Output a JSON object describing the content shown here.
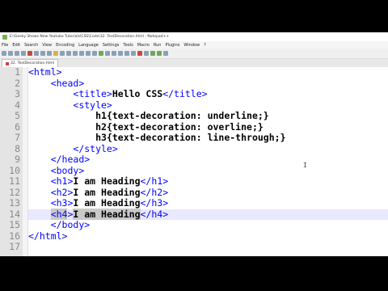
{
  "window": {
    "title": "E:\\Geeky Shows New Youtube Tutorials\\CSS\\Code\\32. TextDecoration.html - Notepad++"
  },
  "menu": [
    "File",
    "Edit",
    "Search",
    "View",
    "Encoding",
    "Language",
    "Settings",
    "Tools",
    "Macro",
    "Run",
    "Plugins",
    "Window",
    "?"
  ],
  "tab": {
    "label": "32. TextDecoration.html"
  },
  "mouse_cursor_glyph": "I",
  "editor": {
    "current_line": 14,
    "lines": [
      {
        "num": "1",
        "indent": "",
        "parts": [
          {
            "t": "<html>",
            "c": "tag"
          }
        ]
      },
      {
        "num": "2",
        "indent": "    ",
        "parts": [
          {
            "t": "<head>",
            "c": "tag"
          }
        ]
      },
      {
        "num": "3",
        "indent": "        ",
        "parts": [
          {
            "t": "<title>",
            "c": "tag"
          },
          {
            "t": "Hello CSS",
            "c": "txt"
          },
          {
            "t": "</title>",
            "c": "tag"
          }
        ]
      },
      {
        "num": "4",
        "indent": "        ",
        "parts": [
          {
            "t": "<style>",
            "c": "tag"
          }
        ]
      },
      {
        "num": "5",
        "indent": "            ",
        "parts": [
          {
            "t": "h1{text-decoration: underline;}",
            "c": "css"
          }
        ]
      },
      {
        "num": "6",
        "indent": "            ",
        "parts": [
          {
            "t": "h2{text-decoration: overline;}",
            "c": "css"
          }
        ]
      },
      {
        "num": "7",
        "indent": "            ",
        "parts": [
          {
            "t": "h3{text-decoration: line-through;}",
            "c": "css"
          }
        ]
      },
      {
        "num": "8",
        "indent": "        ",
        "parts": [
          {
            "t": "</style>",
            "c": "tag"
          }
        ]
      },
      {
        "num": "9",
        "indent": "    ",
        "parts": [
          {
            "t": "</head>",
            "c": "tag"
          }
        ]
      },
      {
        "num": "10",
        "indent": "    ",
        "parts": [
          {
            "t": "<body>",
            "c": "tag"
          }
        ]
      },
      {
        "num": "11",
        "indent": "    ",
        "parts": [
          {
            "t": "<h1>",
            "c": "tag"
          },
          {
            "t": "I am Heading",
            "c": "txt"
          },
          {
            "t": "</h1>",
            "c": "tag"
          }
        ]
      },
      {
        "num": "12",
        "indent": "    ",
        "parts": [
          {
            "t": "<h2>",
            "c": "tag"
          },
          {
            "t": "I am Heading",
            "c": "txt"
          },
          {
            "t": "</h2>",
            "c": "tag"
          }
        ]
      },
      {
        "num": "13",
        "indent": "    ",
        "parts": [
          {
            "t": "<h3>",
            "c": "tag"
          },
          {
            "t": "I am Heading",
            "c": "txt"
          },
          {
            "t": "</h3>",
            "c": "tag"
          }
        ]
      },
      {
        "num": "14",
        "indent": "    ",
        "parts": [
          {
            "t": "<h4",
            "c": "tag",
            "hl": true
          },
          {
            "t": ">",
            "c": "tag"
          },
          {
            "t": "I am Heading",
            "c": "txt",
            "hl": true
          },
          {
            "t": "</h4>",
            "c": "tag"
          }
        ]
      },
      {
        "num": "15",
        "indent": "    ",
        "parts": [
          {
            "t": "</body>",
            "c": "tag"
          }
        ]
      },
      {
        "num": "16",
        "indent": "",
        "parts": [
          {
            "t": "</html>",
            "c": "tag"
          }
        ]
      },
      {
        "num": "17",
        "indent": "",
        "parts": []
      }
    ]
  }
}
